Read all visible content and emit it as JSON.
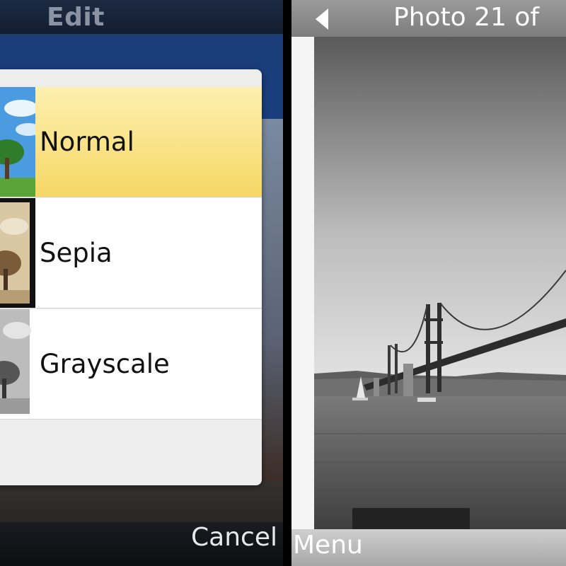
{
  "left_screen": {
    "title": "Edit",
    "filter_menu": {
      "items": [
        {
          "label": "Normal",
          "selected": true
        },
        {
          "label": "Sepia",
          "selected": false
        },
        {
          "label": "Grayscale",
          "selected": false
        }
      ]
    },
    "cancel_label": "Cancel"
  },
  "right_screen": {
    "counter": "Photo 21 of",
    "menu_label": "Menu",
    "back_icon": "back-arrow-icon"
  },
  "colors": {
    "selected_item": "#f6d765",
    "left_background": "#1a3d7a",
    "photo_frame": "#f5f5f5"
  }
}
